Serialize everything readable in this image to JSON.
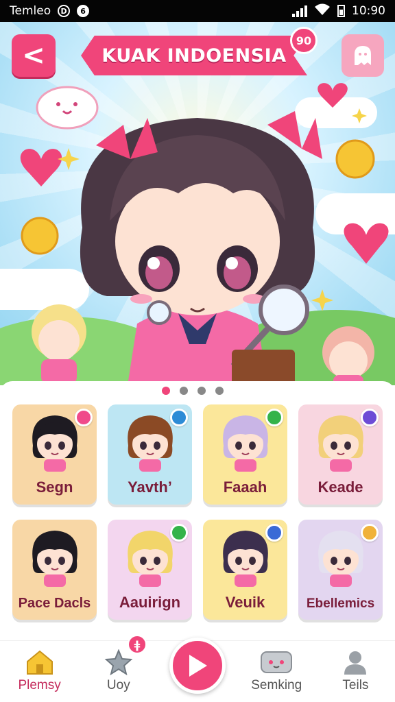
{
  "status_bar": {
    "carrier": "Temleo",
    "time": "10:90"
  },
  "header": {
    "title": "KUAK INDOENSIA",
    "badge_count": "90"
  },
  "hero": {
    "pages": 4,
    "active_page": 1
  },
  "characters": [
    {
      "name": "Segn",
      "bg": "#f8d7a6",
      "hair": "#1e1b22",
      "badge": "#f04a8a"
    },
    {
      "name": "Yavth’",
      "bg": "#bde6f3",
      "hair": "#8b4a25",
      "badge": "#2d8bd6"
    },
    {
      "name": "Faaah",
      "bg": "#fbe79a",
      "hair": "#c9b5e6",
      "badge": "#34b34a"
    },
    {
      "name": "Keade",
      "bg": "#f8d6e0",
      "hair": "#f2d07a",
      "badge": "#6d4cd6"
    },
    {
      "name": "Pace Dacls",
      "bg": "#f8d7a6",
      "hair": "#1e1b22",
      "badge": ""
    },
    {
      "name": "Aauirign",
      "bg": "#f3d6ef",
      "hair": "#f2d56a",
      "badge": "#34b34a"
    },
    {
      "name": "Veuik",
      "bg": "#fbe79a",
      "hair": "#3c2f4e",
      "badge": "#3a6ad6"
    },
    {
      "name": "Ebellemics",
      "bg": "#e3d6f0",
      "hair": "#e4e0f0",
      "badge": "#f0b23a"
    }
  ],
  "tabs": [
    {
      "label": "Plemsy",
      "icon": "house-icon"
    },
    {
      "label": "Uoy",
      "icon": "star-icon"
    },
    {
      "label": "",
      "icon": "play-icon"
    },
    {
      "label": "Semking",
      "icon": "gamepad-icon"
    },
    {
      "label": "Teils",
      "icon": "person-icon"
    }
  ],
  "tab_badge": "ǂ",
  "colors": {
    "accent": "#f0457a",
    "title_text": "#ffffff"
  }
}
